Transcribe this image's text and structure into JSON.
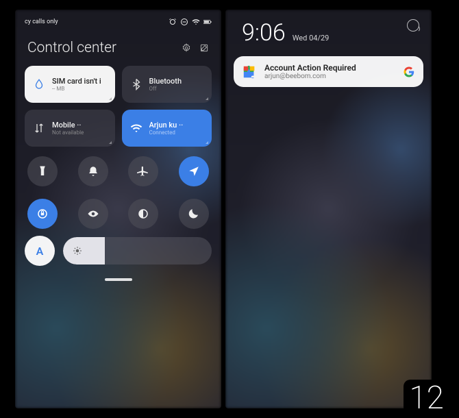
{
  "left": {
    "statusbar": {
      "carrier": "cy calls only"
    },
    "header": {
      "title": "Control center"
    },
    "tiles": {
      "sim": {
        "name": "SIM card isn't i",
        "sub": "-- MB"
      },
      "bluetooth": {
        "name": "Bluetooth",
        "sub": "Off"
      },
      "mobile": {
        "name": "Mobile ··",
        "sub": "Not available"
      },
      "wifi": {
        "name": "Arjun ku ··",
        "sub": "Connected"
      }
    },
    "auto_label": "A"
  },
  "right": {
    "time": "9:06",
    "date": "Wed 04/29",
    "notification": {
      "title": "Account Action Required",
      "subtitle": "arjun@beebom.com"
    }
  },
  "badge": "12"
}
